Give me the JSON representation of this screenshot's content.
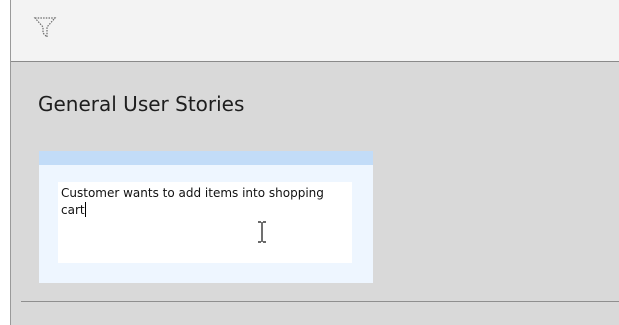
{
  "toolbar": {
    "filter_icon": "filter-funnel-icon"
  },
  "section": {
    "title": "General User Stories"
  },
  "card": {
    "description_text": "Customer wants to add items into shopping cart"
  },
  "colors": {
    "card_header": "#c2dcf8",
    "card_body": "#eef6ff",
    "panel_background": "#d9d9d9",
    "toolbar_background": "#f3f3f3"
  }
}
